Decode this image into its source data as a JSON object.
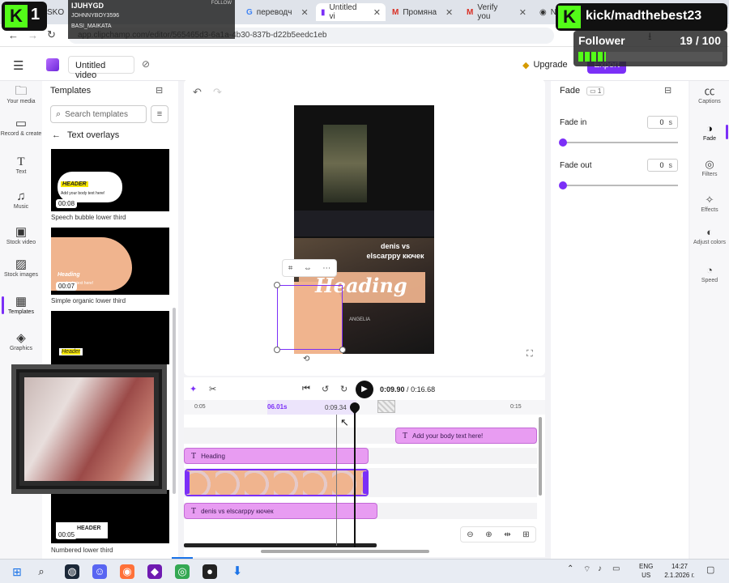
{
  "tabs": [
    {
      "label": "SKO"
    },
    {
      "label": "переводч"
    },
    {
      "label": "Untitled vi"
    },
    {
      "label": "Промяна"
    },
    {
      "label": "Verify you"
    },
    {
      "label": "N"
    }
  ],
  "chat": {
    "title": "IJUHYGD",
    "users": [
      "JOHNNYBOY3596",
      "BASI_MAIKATA"
    ],
    "follow_label": "FOLLOW"
  },
  "address": {
    "url": "app.clipchamp.com/editor/565465d3-6a1a-4b30-837b-d22b5eedc1eb"
  },
  "header": {
    "project_title": "Untitled video",
    "upgrade_label": "Upgrade",
    "export_label": "Export"
  },
  "rail": [
    {
      "label": "Your media",
      "icon": "folder-icon"
    },
    {
      "label": "Record & create",
      "icon": "camera-icon"
    },
    {
      "label": "Text",
      "icon": "text-icon"
    },
    {
      "label": "Music",
      "icon": "music-icon"
    },
    {
      "label": "Stock video",
      "icon": "film-icon"
    },
    {
      "label": "Stock images",
      "icon": "image-icon"
    },
    {
      "label": "Templates",
      "icon": "templates-icon"
    },
    {
      "label": "Graphics",
      "icon": "shapes-icon"
    }
  ],
  "templates": {
    "title": "Templates",
    "search_placeholder": "Search templates",
    "back_label": "Text overlays",
    "items": [
      {
        "caption": "Speech bubble lower third",
        "duration": "00:08",
        "header": "HEADER",
        "body": "Add your body text here!"
      },
      {
        "caption": "Simple organic lower third",
        "duration": "00:07",
        "header": "Heading",
        "body": "your body text here!"
      },
      {
        "caption": "",
        "duration": "",
        "header": "Header",
        "body": ""
      },
      {
        "caption": "Numbered lower third",
        "duration": "00:05",
        "header": "HEADER",
        "body": ""
      }
    ]
  },
  "canvas": {
    "heading_text": "Heading",
    "overlay_line1": "denis vs",
    "overlay_line2": "elscarppy кючек",
    "name_tag": "ANGELIA"
  },
  "timeline": {
    "current_time": "0:09.90",
    "total_time": "0:16.68",
    "ruler": [
      "0:05",
      "06.01s",
      "0:09.34",
      "0:15"
    ],
    "tracks": [
      {
        "label": "Add your body text here!"
      },
      {
        "label": "Heading"
      },
      {
        "label": "denis vs elscarppy кючек"
      }
    ]
  },
  "properties": {
    "title": "Fade",
    "badge": "1",
    "fade_in_label": "Fade in",
    "fade_in_value": "0",
    "fade_out_label": "Fade out",
    "fade_out_value": "0",
    "unit": "s"
  },
  "right_rail": [
    {
      "label": "Captions",
      "icon": "captions-icon"
    },
    {
      "label": "Fade",
      "icon": "fade-icon"
    },
    {
      "label": "Filters",
      "icon": "filters-icon"
    },
    {
      "label": "Effects",
      "icon": "effects-icon"
    },
    {
      "label": "Adjust colors",
      "icon": "adjust-colors-icon"
    },
    {
      "label": "Speed",
      "icon": "speed-icon"
    }
  ],
  "kick": {
    "logo_text": "1",
    "channel": "kick/madthebest23",
    "goal_label": "Follower",
    "goal_count": "19 / 100",
    "goal_progress": 0.19
  },
  "taskbar": {
    "lang": "ENG",
    "region": "US",
    "time": "14:27",
    "date": "2.1.2026 г."
  },
  "colors": {
    "accent": "#7b2ff7",
    "kick_green": "#53fc18",
    "track_pink": "#e89cf2"
  }
}
